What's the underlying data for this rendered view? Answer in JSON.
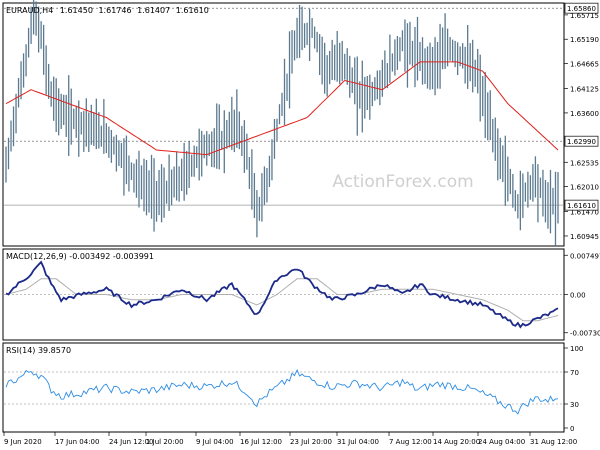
{
  "chart_data": [
    {
      "type": "bar",
      "title": "EURAUD,H4",
      "ohlc_header": [
        "1.61450",
        "1.61746",
        "1.61407",
        "1.61610"
      ],
      "y_ticks": [
        "1.65860",
        "1.65715",
        "1.65190",
        "1.64665",
        "1.64125",
        "1.63600",
        "1.62990",
        "1.62535",
        "1.62010",
        "1.61610",
        "1.61470",
        "1.60945"
      ],
      "ylim": [
        1.6075,
        1.6595
      ],
      "reference_levels": [
        {
          "value": 1.6586,
          "label": "1.65860"
        },
        {
          "value": 1.6299,
          "label": "1.62990"
        },
        {
          "value": 1.6161,
          "label": "1.61610"
        }
      ],
      "watermark": "ActionForex.com",
      "colors": {
        "bars": "#5b7a90",
        "moving_average": "#e0201a"
      },
      "price_keypoints": [
        [
          0,
          1.624
        ],
        [
          3,
          1.634
        ],
        [
          8,
          1.648
        ],
        [
          11,
          1.658
        ],
        [
          14,
          1.652
        ],
        [
          18,
          1.64
        ],
        [
          22,
          1.636
        ],
        [
          30,
          1.634
        ],
        [
          40,
          1.631
        ],
        [
          48,
          1.625
        ],
        [
          55,
          1.62
        ],
        [
          62,
          1.618
        ],
        [
          70,
          1.622
        ],
        [
          78,
          1.628
        ],
        [
          86,
          1.63
        ],
        [
          92,
          1.634
        ],
        [
          96,
          1.627
        ],
        [
          100,
          1.614
        ],
        [
          104,
          1.621
        ],
        [
          110,
          1.638
        ],
        [
          116,
          1.652
        ],
        [
          122,
          1.654
        ],
        [
          128,
          1.645
        ],
        [
          134,
          1.648
        ],
        [
          140,
          1.64
        ],
        [
          146,
          1.64
        ],
        [
          152,
          1.645
        ],
        [
          158,
          1.651
        ],
        [
          164,
          1.648
        ],
        [
          170,
          1.646
        ],
        [
          176,
          1.65
        ],
        [
          182,
          1.648
        ],
        [
          188,
          1.644
        ],
        [
          192,
          1.635
        ],
        [
          196,
          1.628
        ],
        [
          200,
          1.622
        ],
        [
          204,
          1.616
        ],
        [
          208,
          1.62
        ],
        [
          211,
          1.622
        ],
        [
          215,
          1.617
        ],
        [
          220,
          1.616
        ]
      ],
      "moving_average": [
        [
          0,
          1.638
        ],
        [
          10,
          1.641
        ],
        [
          20,
          1.639
        ],
        [
          40,
          1.635
        ],
        [
          60,
          1.628
        ],
        [
          80,
          1.627
        ],
        [
          100,
          1.631
        ],
        [
          120,
          1.635
        ],
        [
          135,
          1.643
        ],
        [
          150,
          1.641
        ],
        [
          165,
          1.647
        ],
        [
          180,
          1.647
        ],
        [
          190,
          1.645
        ],
        [
          200,
          1.638
        ],
        [
          210,
          1.633
        ],
        [
          220,
          1.628
        ]
      ]
    },
    {
      "type": "line",
      "title": "MACD(12,26,9) -0.003492 -0.003991",
      "y_ticks": [
        "0.007497",
        "0.00",
        "-0.007306"
      ],
      "ylim": [
        -0.0085,
        0.0085
      ],
      "macd_keypoints": [
        [
          0,
          0.0
        ],
        [
          5,
          0.002
        ],
        [
          10,
          0.004
        ],
        [
          14,
          0.006
        ],
        [
          18,
          0.002
        ],
        [
          22,
          -0.001
        ],
        [
          30,
          0.0
        ],
        [
          40,
          0.001
        ],
        [
          50,
          -0.002
        ],
        [
          60,
          -0.001
        ],
        [
          70,
          0.001
        ],
        [
          80,
          -0.001
        ],
        [
          90,
          0.002
        ],
        [
          100,
          -0.004
        ],
        [
          108,
          0.003
        ],
        [
          116,
          0.005
        ],
        [
          122,
          0.002
        ],
        [
          130,
          -0.001
        ],
        [
          140,
          0.0
        ],
        [
          150,
          0.002
        ],
        [
          158,
          0.0
        ],
        [
          165,
          0.002
        ],
        [
          170,
          0.0
        ],
        [
          180,
          -0.001
        ],
        [
          190,
          -0.002
        ],
        [
          200,
          -0.005
        ],
        [
          205,
          -0.006
        ],
        [
          210,
          -0.005
        ],
        [
          220,
          -0.003
        ]
      ],
      "signal_keypoints": [
        [
          0,
          0.0
        ],
        [
          8,
          0.001
        ],
        [
          14,
          0.003
        ],
        [
          20,
          0.003
        ],
        [
          28,
          0.0
        ],
        [
          40,
          0.0
        ],
        [
          50,
          -0.001
        ],
        [
          60,
          -0.001
        ],
        [
          70,
          0.0
        ],
        [
          80,
          0.0
        ],
        [
          90,
          0.0
        ],
        [
          100,
          -0.002
        ],
        [
          108,
          0.0
        ],
        [
          116,
          0.003
        ],
        [
          124,
          0.003
        ],
        [
          132,
          0.0
        ],
        [
          140,
          0.0
        ],
        [
          150,
          0.001
        ],
        [
          160,
          0.001
        ],
        [
          170,
          0.001
        ],
        [
          180,
          0.0
        ],
        [
          190,
          -0.001
        ],
        [
          200,
          -0.003
        ],
        [
          206,
          -0.005
        ],
        [
          212,
          -0.005
        ],
        [
          220,
          -0.004
        ]
      ],
      "colors": {
        "macd": "#1c2a8a",
        "signal": "#b0b0b0"
      }
    },
    {
      "type": "line",
      "title": "RSI(14) 39.8570",
      "y_ticks": [
        "100",
        "70",
        "30",
        "0"
      ],
      "levels": [
        70,
        30
      ],
      "ylim": [
        0,
        100
      ],
      "rsi_keypoints": [
        [
          0,
          55
        ],
        [
          5,
          62
        ],
        [
          10,
          72
        ],
        [
          14,
          65
        ],
        [
          18,
          48
        ],
        [
          22,
          40
        ],
        [
          30,
          44
        ],
        [
          40,
          50
        ],
        [
          50,
          45
        ],
        [
          60,
          48
        ],
        [
          70,
          54
        ],
        [
          80,
          52
        ],
        [
          90,
          58
        ],
        [
          96,
          45
        ],
        [
          100,
          30
        ],
        [
          104,
          42
        ],
        [
          110,
          55
        ],
        [
          116,
          68
        ],
        [
          122,
          60
        ],
        [
          130,
          52
        ],
        [
          140,
          56
        ],
        [
          150,
          50
        ],
        [
          158,
          58
        ],
        [
          164,
          48
        ],
        [
          172,
          55
        ],
        [
          180,
          52
        ],
        [
          186,
          48
        ],
        [
          192,
          40
        ],
        [
          198,
          30
        ],
        [
          204,
          22
        ],
        [
          208,
          32
        ],
        [
          212,
          38
        ],
        [
          216,
          34
        ],
        [
          220,
          40
        ]
      ],
      "colors": {
        "rsi": "#2f8de4",
        "levels": "#b0b0b0"
      }
    }
  ],
  "x_axis": {
    "n_bars": 220,
    "ticks": [
      {
        "label": "9 Jun 2020",
        "bar": 0
      },
      {
        "label": "17 Jun 04:00",
        "bar": 25
      },
      {
        "label": "24 Jun 12:00",
        "bar": 48
      },
      {
        "label": "1 Jul 20:00",
        "bar": 71
      },
      {
        "label": "9 Jul 04:00",
        "bar": 94
      },
      {
        "label": "16 Jul 12:00",
        "bar": 116
      },
      {
        "label": "23 Jul 20:00",
        "bar": 139
      },
      {
        "label": "31 Jul 04:00",
        "bar": 161
      },
      {
        "label": "7 Aug 12:00",
        "bar": 184
      },
      {
        "label": "14 Aug 20:00",
        "bar": 205
      },
      {
        "label": "24 Aug 04:00",
        "bar": 219
      },
      {
        "label": "31 Aug 12:00",
        "bar": 220
      }
    ]
  }
}
